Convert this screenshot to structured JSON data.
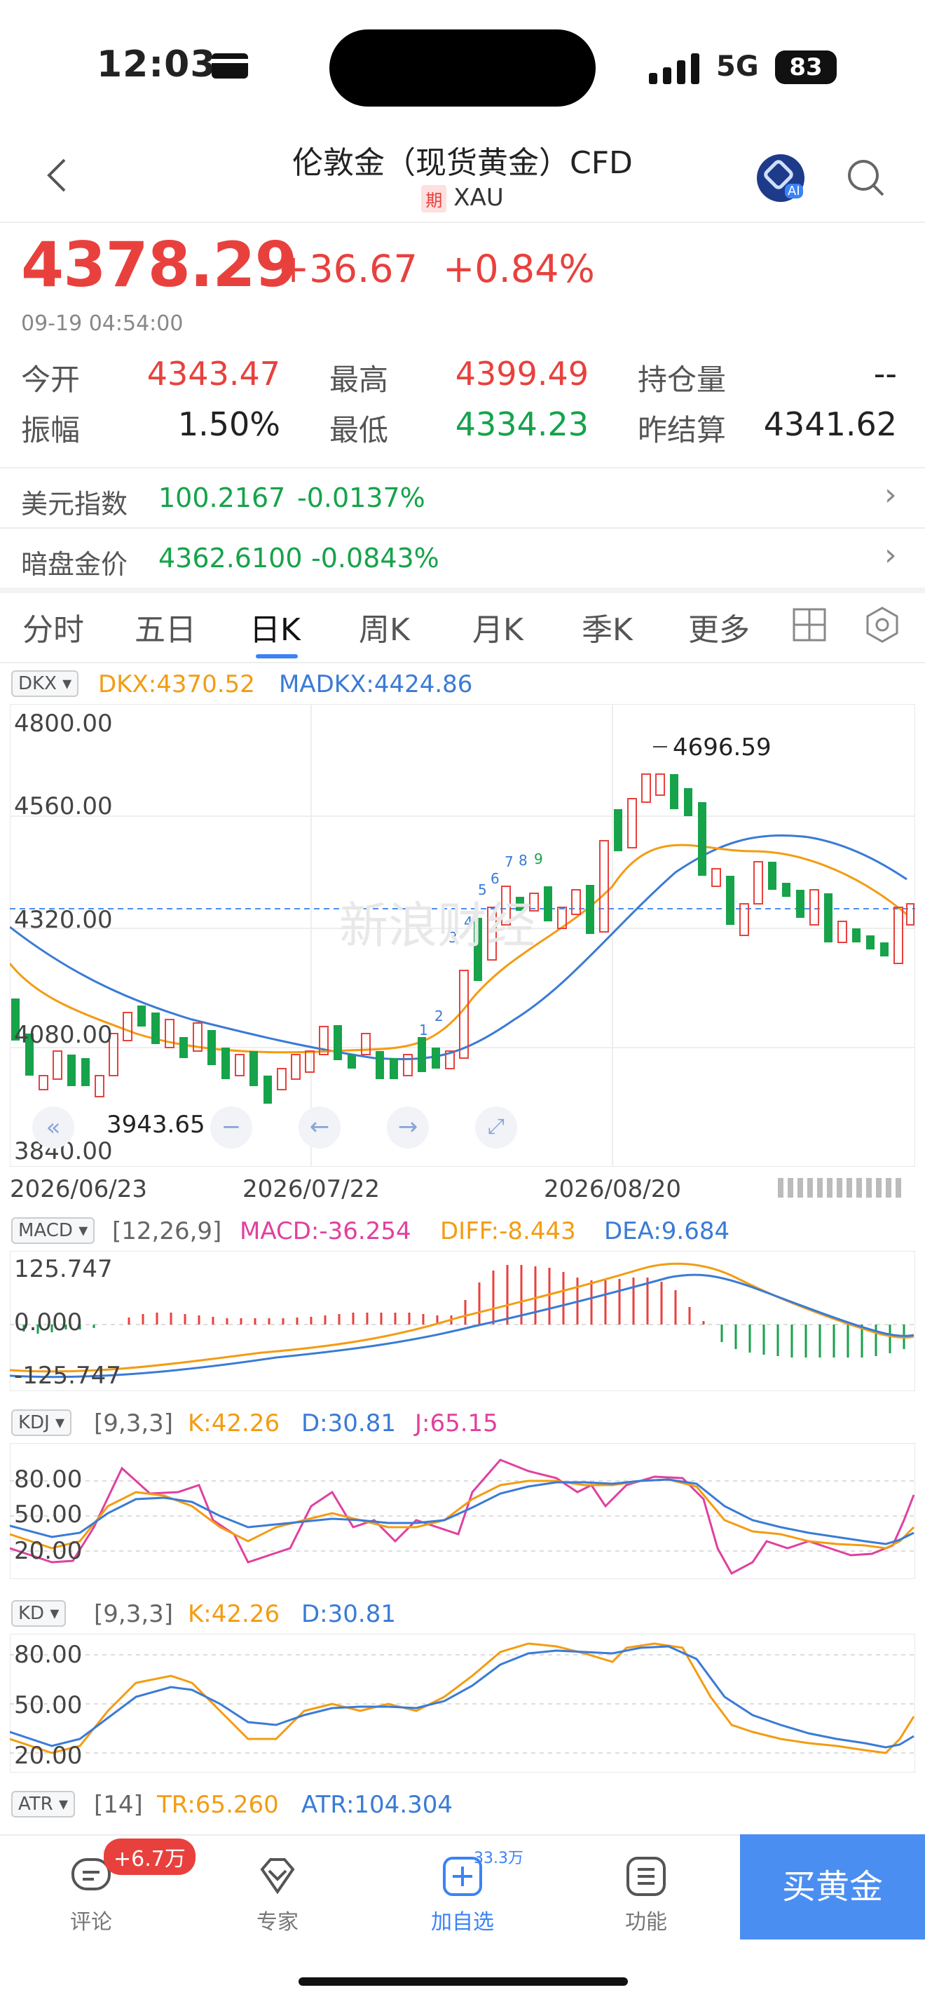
{
  "status_bar": {
    "time": "12:03",
    "network": "5G",
    "battery": "83"
  },
  "header": {
    "title": "伦敦金（现货黄金）CFD",
    "badge": "期",
    "symbol": "XAU"
  },
  "quote": {
    "price": "4378.29",
    "change": "+36.67",
    "change_pct": "+0.84%",
    "timestamp": "09-19 04:54:00",
    "open_label": "今开",
    "open": "4343.47",
    "high_label": "最高",
    "high": "4399.49",
    "oi_label": "持仓量",
    "oi": "--",
    "amp_label": "振幅",
    "amp": "1.50%",
    "low_label": "最低",
    "low": "4334.23",
    "prev_label": "昨结算",
    "prev": "4341.62"
  },
  "indices": [
    {
      "label": "美元指数",
      "value": "100.2167",
      "change": "-0.0137%"
    },
    {
      "label": "暗盘金价",
      "value": "4362.6100",
      "change": "-0.0843%"
    }
  ],
  "tabs": [
    "分时",
    "五日",
    "日K",
    "周K",
    "月K",
    "季K",
    "更多"
  ],
  "active_tab": "日K",
  "main_chart": {
    "pill": "DKX",
    "dkx": "DKX:4370.52",
    "madkx": "MADKX:4424.86",
    "y_labels": [
      "4800.00",
      "4560.00",
      "4320.00",
      "4080.00",
      "3840.00"
    ],
    "x_labels": [
      "2026/06/23",
      "2026/07/22",
      "2026/08/20"
    ],
    "max_label": "4696.59",
    "min_label": "3943.65",
    "watermark": "新浪财经"
  },
  "macd": {
    "pill": "MACD",
    "params": "[12,26,9]",
    "macd": "MACD:-36.254",
    "diff": "DIFF:-8.443",
    "dea": "DEA:9.684",
    "y_top": "125.747",
    "y_mid": "0.000",
    "y_bot": "-125.747"
  },
  "kdj": {
    "pill": "KDJ",
    "params": "[9,3,3]",
    "k": "K:42.26",
    "d": "D:30.81",
    "j": "J:65.15",
    "y": [
      "80.00",
      "50.00",
      "20.00"
    ]
  },
  "kd": {
    "pill": "KD",
    "params": "[9,3,3]",
    "k": "K:42.26",
    "d": "D:30.81",
    "y": [
      "80.00",
      "50.00",
      "20.00"
    ]
  },
  "atr": {
    "pill": "ATR",
    "params": "[14]",
    "tr": "TR:65.260",
    "atr": "ATR:104.304"
  },
  "bottom_nav": {
    "comment": "评论",
    "comment_badge": "+6.7万",
    "expert": "专家",
    "watch": "加自选",
    "watch_count": "33.3万",
    "func": "功能",
    "buy": "买黄金"
  },
  "colors": {
    "up": "#e8413d",
    "down": "#16a34a",
    "accent": "#4a8ef2"
  }
}
